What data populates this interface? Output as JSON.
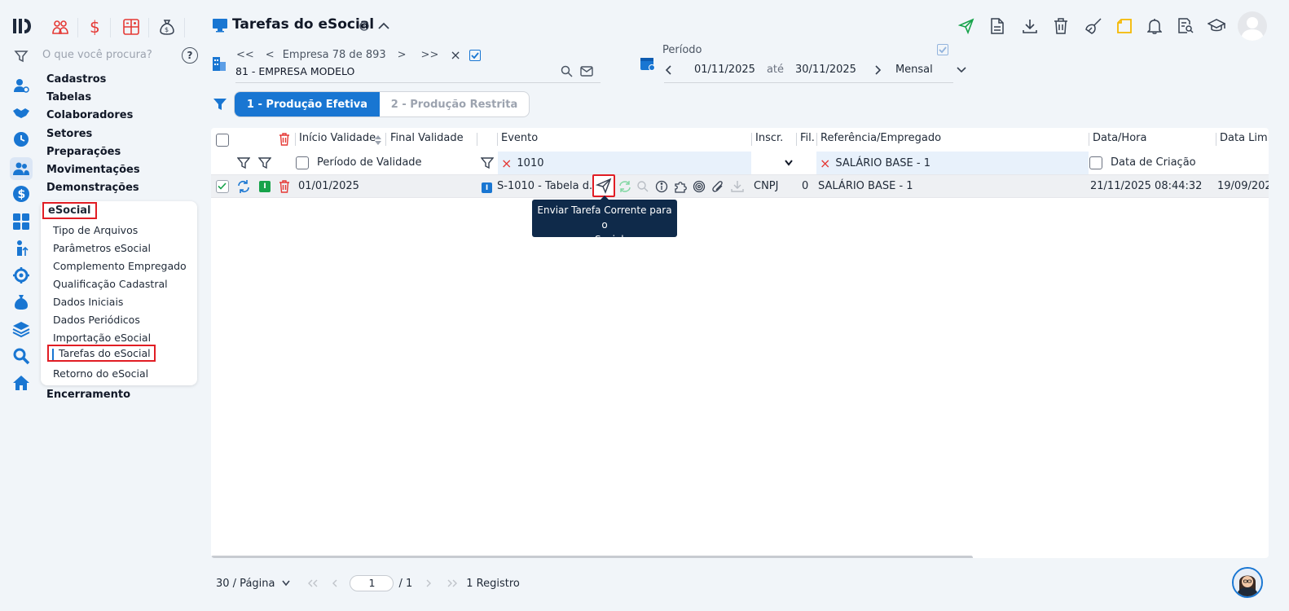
{
  "app": {
    "title": "Tarefas do eSocial"
  },
  "search": {
    "placeholder": "O que você procura?",
    "help": "?"
  },
  "sidebar": {
    "items": [
      {
        "label": "Cadastros"
      },
      {
        "label": "Tabelas"
      },
      {
        "label": "Colaboradores"
      },
      {
        "label": "Setores"
      },
      {
        "label": "Preparações"
      },
      {
        "label": "Movimentações"
      },
      {
        "label": "Demonstrações"
      },
      {
        "label": "Encerramento"
      }
    ],
    "esocial": {
      "title": "eSocial",
      "items": [
        {
          "label": "Tipo de Arquivos"
        },
        {
          "label": "Parâmetros eSocial"
        },
        {
          "label": "Complemento Empregado"
        },
        {
          "label": "Qualificação Cadastral"
        },
        {
          "label": "Dados Iniciais"
        },
        {
          "label": "Dados Periódicos"
        },
        {
          "label": "Importação eSocial"
        },
        {
          "label": "Tarefas do eSocial"
        },
        {
          "label": "Retorno do eSocial"
        }
      ]
    }
  },
  "company": {
    "first": "<<",
    "prev": "<",
    "counter": "Empresa 78 de 893",
    "next": ">",
    "last": ">>",
    "clear": "×",
    "name": "81 - EMPRESA MODELO"
  },
  "period": {
    "label": "Período",
    "start": "01/11/2025",
    "until": "até",
    "end": "30/11/2025",
    "mode": "Mensal"
  },
  "tabs": [
    {
      "label": "1 - Produção Efetiva",
      "active": true
    },
    {
      "label": "2 - Produção Restrita",
      "active": false
    }
  ],
  "grid": {
    "columns": {
      "inicio": "Início Validade",
      "final": "Final Validade",
      "evento": "Evento",
      "inscr": "Inscr.",
      "fil": "Fil.",
      "referencia": "Referência/Empregado",
      "datahora": "Data/Hora",
      "datalimite": "Data Limi"
    },
    "filters": {
      "periodo": "Período de Validade",
      "evento": "1010",
      "referencia": "SALÁRIO BASE - 1",
      "criacao": "Data de Criação"
    },
    "rows": [
      {
        "badge": "I",
        "inicio": "01/01/2025",
        "evento_badge": "I",
        "evento": "S-1010 - Tabela d...",
        "inscr": "CNPJ",
        "fil": "0",
        "referencia": "SALÁRIO BASE - 1",
        "datahora": "21/11/2025 08:44:32",
        "datalimite": "19/09/202"
      }
    ]
  },
  "tooltip": {
    "line1": "Enviar Tarefa Corrente para o",
    "line2": "e-Social"
  },
  "pager": {
    "per_page": "30 / Página",
    "page": "1",
    "total": "/ 1",
    "records": "1 Registro"
  },
  "colors": {
    "primary": "#1976d2",
    "highlight": "#e11d24",
    "tooltip": "#0f2a4a",
    "warning": "#f5b800",
    "success": "#16a34a"
  }
}
